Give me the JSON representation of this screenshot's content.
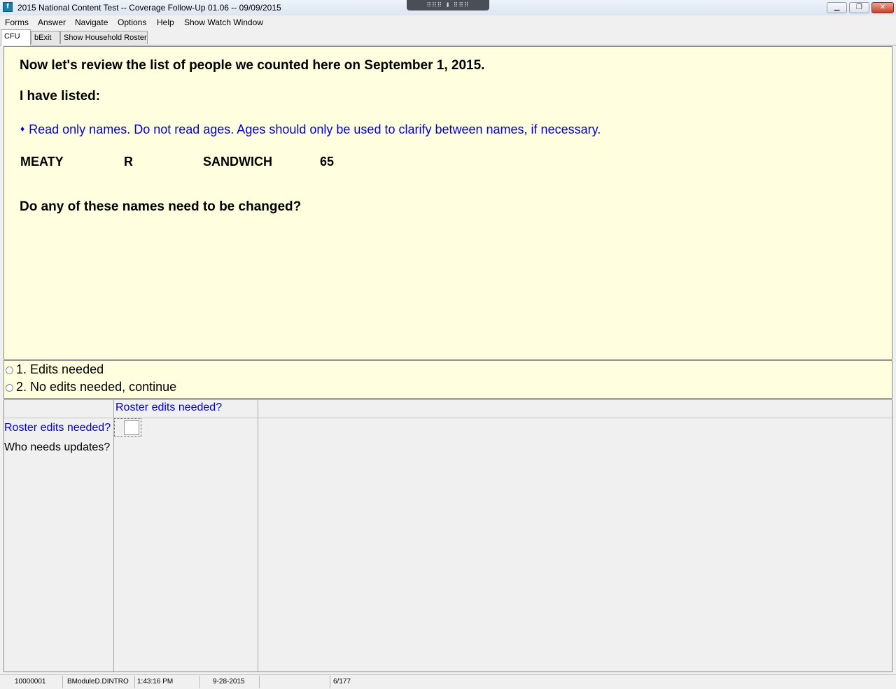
{
  "window": {
    "title": "2015 National Content Test -- Coverage Follow-Up 01.06 -- 09/09/2015",
    "minimize_glyph": "▁",
    "restore_glyph": "❐",
    "close_glyph": "✕",
    "dock_handle_text": "⠿⠿⠿ ⬇ ⠿⠿⠿"
  },
  "menu": {
    "items": [
      "Forms",
      "Answer",
      "Navigate",
      "Options",
      "Help",
      "Show Watch Window"
    ]
  },
  "tabs": [
    {
      "label": "CFU",
      "active": true
    },
    {
      "label": "bExit",
      "active": false
    },
    {
      "label": "Show Household Roster",
      "active": false
    }
  ],
  "question": {
    "intro": "Now let's review the list of people we counted here on September 1, 2015.",
    "listed_label": "I have listed:",
    "instruction_bullet": "♦",
    "instruction": "Read only names. Do not read ages. Ages should only be used to clarify between names, if necessary.",
    "roster": {
      "first_name": "MEATY",
      "middle_initial": "R",
      "last_name": "SANDWICH",
      "age": "65"
    },
    "prompt": "Do any of these names need to be changed?"
  },
  "answers": [
    {
      "label": "1. Edits needed"
    },
    {
      "label": "2. No edits needed, continue"
    }
  ],
  "grid": {
    "column_header": "Roster edits needed?",
    "row_labels": [
      "Roster edits needed?",
      "Who needs updates?"
    ],
    "entry_value": ""
  },
  "status": {
    "case_id": "10000001",
    "field_name": "BModuleD.DINTRO",
    "time": "1:43:16 PM",
    "date": "9-28-2015",
    "blank": "",
    "page": "6/177"
  },
  "colors": {
    "panel_background": "#ffffdf",
    "instruction_text": "#0000dd",
    "window_background": "#f0f0f0"
  }
}
